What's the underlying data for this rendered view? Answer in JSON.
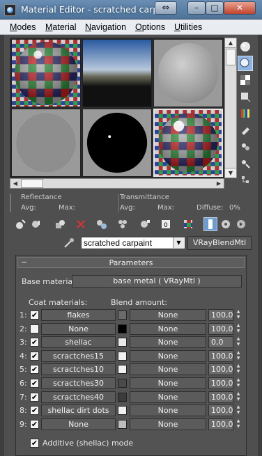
{
  "window": {
    "title": "Material Editor - scratched carpaint",
    "swap_icon": "swap-arrows-icon",
    "minimize_glyph": "–",
    "maximize_glyph": "□",
    "close_glyph": "✕"
  },
  "menu": [
    "Modes",
    "Material",
    "Navigation",
    "Options",
    "Utilities"
  ],
  "slots": [
    {
      "name": "checker-sphere",
      "active": false
    },
    {
      "name": "sky-environment",
      "active": false
    },
    {
      "name": "gray-sphere",
      "active": false
    },
    {
      "name": "noise-sphere",
      "active": false
    },
    {
      "name": "black-sphere",
      "active": false
    },
    {
      "name": "checker-sphere-glossy",
      "active": true
    }
  ],
  "side_tools": [
    "sample-type-icon",
    "backlight-icon",
    "background-icon",
    "sample-uv-tiling-icon",
    "video-color-check-icon",
    "make-preview-icon",
    "options-icon",
    "select-by-material-icon",
    "material-map-navigator-icon"
  ],
  "info": {
    "reflectance": "Reflectance",
    "avg": "Avg:",
    "max": "Max:",
    "transmittance": "Transmittance",
    "diffuse": "Diffuse:",
    "diffuse_value": "0%"
  },
  "toolbar": [
    "get-material-icon",
    "put-material-icon",
    "assign-material-icon",
    "reset-map-icon",
    "copy-material-icon",
    "make-unique-icon",
    "put-to-library-icon",
    "material-id-channel-icon",
    "show-shaded-material-icon",
    "show-end-result-icon",
    "go-to-parent-icon",
    "go-forward-sibling-icon"
  ],
  "material": {
    "name": "scratched carpaint",
    "type": "VRayBlendMtl"
  },
  "parameters": {
    "title": "Parameters",
    "collapse": "−",
    "base_label": "Base material:",
    "base_value": "base metal  ( VRayMtl )",
    "coat_header": "Coat materials:",
    "blend_header": "Blend amount:",
    "coats": [
      {
        "num": "1:",
        "checked": true,
        "name": "flakes",
        "swatch": "#6b6b6b",
        "blend": "None",
        "value": "100,0"
      },
      {
        "num": "2:",
        "checked": false,
        "name": "None",
        "swatch": "#000000",
        "blend": "None",
        "value": "100,0"
      },
      {
        "num": "3:",
        "checked": true,
        "name": "shellac",
        "swatch": "#e8e8e8",
        "blend": "None",
        "value": "0,0"
      },
      {
        "num": "4:",
        "checked": true,
        "name": "scractches15",
        "swatch": "#f0f0f0",
        "blend": "None",
        "value": "100,0"
      },
      {
        "num": "5:",
        "checked": true,
        "name": "scractches10",
        "swatch": "#f0f0f0",
        "blend": "None",
        "value": "100,0"
      },
      {
        "num": "6:",
        "checked": true,
        "name": "scractches30",
        "swatch": "#4a4a4a",
        "blend": "None",
        "value": "100,0"
      },
      {
        "num": "7:",
        "checked": true,
        "name": "scractches40",
        "swatch": "#3c3c3c",
        "blend": "None",
        "value": "100,0"
      },
      {
        "num": "8:",
        "checked": true,
        "name": "shellac dirt dots",
        "swatch": "#f0f0f0",
        "blend": "None",
        "value": "100,0"
      },
      {
        "num": "9:",
        "checked": true,
        "name": "None",
        "swatch": "#bdbdbd",
        "blend": "None",
        "value": "100,0"
      }
    ],
    "additive_checked": true,
    "additive_label": "Additive (shellac) mode"
  },
  "check_glyph": "✔"
}
